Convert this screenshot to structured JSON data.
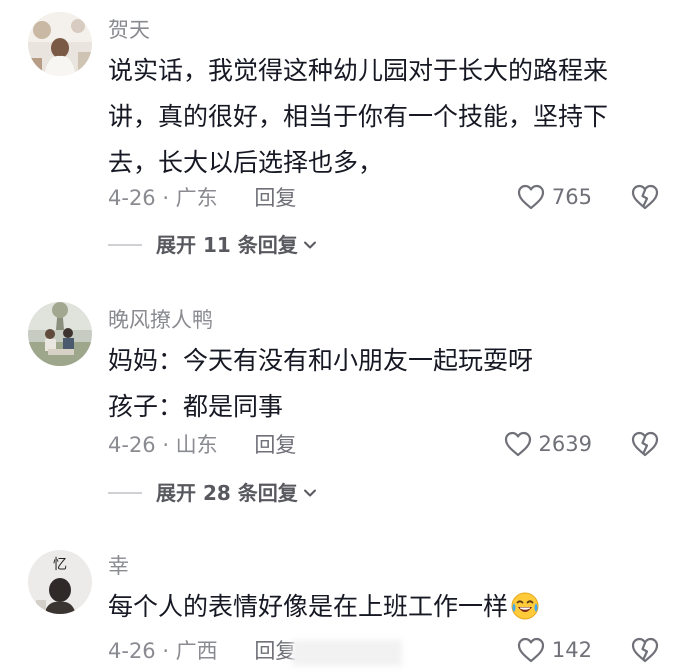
{
  "comments": [
    {
      "username": "贺天",
      "lines": [
        "说实话，我觉得这种幼儿园对于长大的路程来",
        "讲，真的很好，相当于你有一个技能，坚持下",
        "去，长大以后选择也多，"
      ],
      "date_location": "4-26 · 广东",
      "reply_label": "回复",
      "likes": "765",
      "expand_label": "展开 11 条回复"
    },
    {
      "username": "晚风撩人鸭",
      "lines": [
        "妈妈：今天有没有和小朋友一起玩耍呀",
        "孩子：都是同事"
      ],
      "date_location": "4-26 · 山东",
      "reply_label": "回复",
      "likes": "2639",
      "expand_label": "展开 28 条回复"
    },
    {
      "username": "幸",
      "lines": [
        "每个人的表情好像是在上班工作一样"
      ],
      "date_location": "4-26 · 广西",
      "reply_label": "回复",
      "likes": "142",
      "avatar_text": "忆"
    }
  ],
  "colors": {
    "text_primary": "#161823",
    "text_secondary": "#8a8b91",
    "icon_gray": "#6f7078",
    "divider": "#d0d1d5"
  },
  "icons": {
    "like": "heart-outline-icon",
    "dislike": "broken-heart-icon",
    "expand": "chevron-down-icon",
    "emoji": "laughing-crying-emoji-icon"
  }
}
